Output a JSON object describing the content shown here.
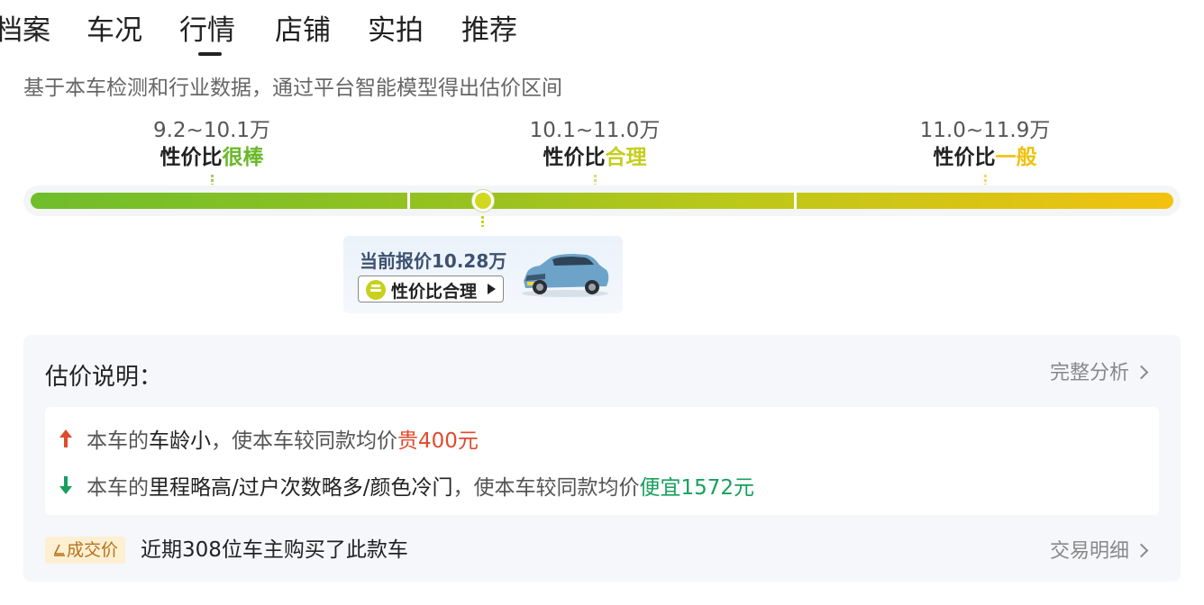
{
  "tabs": [
    {
      "label": "档案",
      "active": false
    },
    {
      "label": "车况",
      "active": false
    },
    {
      "label": "行情",
      "active": true
    },
    {
      "label": "店铺",
      "active": false
    },
    {
      "label": "实拍",
      "active": false
    },
    {
      "label": "推荐",
      "active": false
    }
  ],
  "subtitle": "基于本车检测和行业数据，通过平台智能模型得出估价区间",
  "bands": [
    {
      "range": "9.2~10.1万",
      "prefix": "性价比",
      "rating": "很棒",
      "color": "#6ab82a"
    },
    {
      "range": "10.1~11.0万",
      "prefix": "性价比",
      "rating": "合理",
      "color": "#c4cf1c"
    },
    {
      "range": "11.0~11.9万",
      "prefix": "性价比",
      "rating": "一般",
      "color": "#f0c10f"
    }
  ],
  "current_price": {
    "label": "当前报价10.28万",
    "value_wan": 10.28,
    "tag": "性价比合理",
    "tag_icon": "neutral-face-icon"
  },
  "explanation": {
    "title": "估价说明：",
    "full_analysis": "完整分析",
    "items": [
      {
        "direction": "up",
        "lead": "本车的",
        "factor": "车龄小",
        "middle": "，使本车较同款均价",
        "result": "贵400元",
        "color": "#e04a2d"
      },
      {
        "direction": "down",
        "lead": "本车的",
        "factor": "里程略高/过户次数略多/颜色冷门",
        "middle": "，使本车较同款均价",
        "result": "便宜1572元",
        "color": "#17a05d"
      }
    ],
    "deal_badge": "成交价",
    "deal_text": "近期308位车主购买了此款车",
    "deal_link": "交易明细"
  }
}
